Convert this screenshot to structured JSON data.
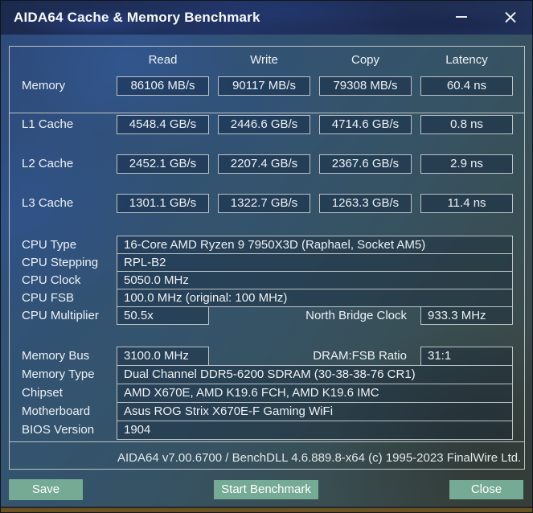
{
  "window": {
    "title": "AIDA64 Cache & Memory Benchmark"
  },
  "benchmark": {
    "columns": [
      "Read",
      "Write",
      "Copy",
      "Latency"
    ],
    "rows": [
      {
        "label": "Memory",
        "read": "86106 MB/s",
        "write": "90117 MB/s",
        "copy": "79308 MB/s",
        "latency": "60.4 ns"
      },
      {
        "label": "L1 Cache",
        "read": "4548.4 GB/s",
        "write": "2446.6 GB/s",
        "copy": "4714.6 GB/s",
        "latency": "0.8 ns"
      },
      {
        "label": "L2 Cache",
        "read": "2452.1 GB/s",
        "write": "2207.4 GB/s",
        "copy": "2367.6 GB/s",
        "latency": "2.9 ns"
      },
      {
        "label": "L3 Cache",
        "read": "1301.1 GB/s",
        "write": "1322.7 GB/s",
        "copy": "1263.3 GB/s",
        "latency": "11.4 ns"
      }
    ]
  },
  "cpu": {
    "type_label": "CPU Type",
    "type": "16-Core AMD Ryzen 9 7950X3D  (Raphael, Socket AM5)",
    "stepping_label": "CPU Stepping",
    "stepping": "RPL-B2",
    "clock_label": "CPU Clock",
    "clock": "5050.0 MHz",
    "fsb_label": "CPU FSB",
    "fsb": "100.0 MHz  (original: 100 MHz)",
    "multiplier_label": "CPU Multiplier",
    "multiplier": "50.5x",
    "nb_clock_label": "North Bridge Clock",
    "nb_clock": "933.3 MHz"
  },
  "memory": {
    "bus_label": "Memory Bus",
    "bus": "3100.0 MHz",
    "dram_fsb_label": "DRAM:FSB Ratio",
    "dram_fsb": "31:1",
    "type_label": "Memory Type",
    "type": "Dual Channel DDR5-6200 SDRAM  (30-38-38-76 CR1)",
    "chipset_label": "Chipset",
    "chipset": "AMD X670E, AMD K19.6 FCH, AMD K19.6 IMC",
    "motherboard_label": "Motherboard",
    "motherboard": "Asus ROG Strix X670E-F Gaming WiFi",
    "bios_label": "BIOS Version",
    "bios": "1904"
  },
  "footer": {
    "version": "AIDA64 v7.00.6700 / BenchDLL 4.6.889.8-x64  (c) 1995-2023 FinalWire Ltd."
  },
  "buttons": {
    "save": "Save",
    "start": "Start Benchmark",
    "close": "Close"
  },
  "colors": {
    "button_green": "#75aa94",
    "bottom_bar_brown": "#6b5220",
    "box_border": "#bcc3c7",
    "titlebar_navy": "#1e2c52"
  }
}
